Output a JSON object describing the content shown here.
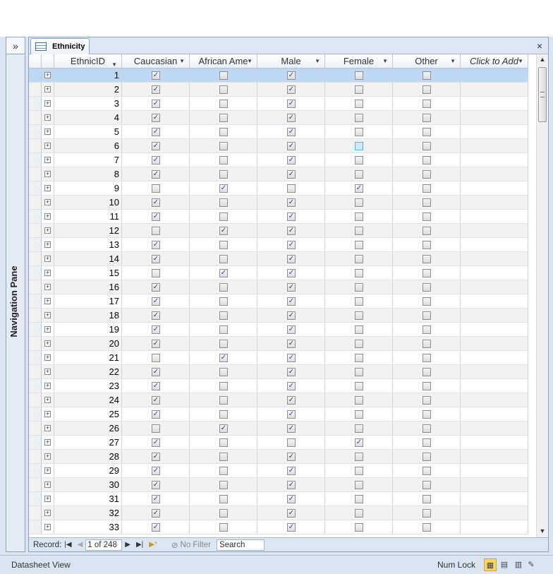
{
  "nav_pane": {
    "toggle": "»",
    "label": "Navigation Pane"
  },
  "tab": {
    "label": "Ethnicity",
    "close": "×"
  },
  "columns": [
    "EthnicID",
    "Caucasian",
    "African Ame",
    "Male",
    "Female",
    "Other",
    "Click to Add"
  ],
  "rows": [
    {
      "id": "1",
      "cau": 1,
      "afr": 0,
      "male": 1,
      "fem": 0,
      "oth": 0
    },
    {
      "id": "2",
      "cau": 1,
      "afr": 0,
      "male": 1,
      "fem": 0,
      "oth": 0
    },
    {
      "id": "3",
      "cau": 1,
      "afr": 0,
      "male": 1,
      "fem": 0,
      "oth": 0
    },
    {
      "id": "4",
      "cau": 1,
      "afr": 0,
      "male": 1,
      "fem": 0,
      "oth": 0
    },
    {
      "id": "5",
      "cau": 1,
      "afr": 0,
      "male": 1,
      "fem": 0,
      "oth": 0
    },
    {
      "id": "6",
      "cau": 1,
      "afr": 0,
      "male": 1,
      "fem": 0,
      "oth": 0
    },
    {
      "id": "7",
      "cau": 1,
      "afr": 0,
      "male": 1,
      "fem": 0,
      "oth": 0
    },
    {
      "id": "8",
      "cau": 1,
      "afr": 0,
      "male": 1,
      "fem": 0,
      "oth": 0
    },
    {
      "id": "9",
      "cau": 0,
      "afr": 1,
      "male": 0,
      "fem": 1,
      "oth": 0
    },
    {
      "id": "10",
      "cau": 1,
      "afr": 0,
      "male": 1,
      "fem": 0,
      "oth": 0
    },
    {
      "id": "11",
      "cau": 1,
      "afr": 0,
      "male": 1,
      "fem": 0,
      "oth": 0
    },
    {
      "id": "12",
      "cau": 0,
      "afr": 1,
      "male": 1,
      "fem": 0,
      "oth": 0
    },
    {
      "id": "13",
      "cau": 1,
      "afr": 0,
      "male": 1,
      "fem": 0,
      "oth": 0
    },
    {
      "id": "14",
      "cau": 1,
      "afr": 0,
      "male": 1,
      "fem": 0,
      "oth": 0
    },
    {
      "id": "15",
      "cau": 0,
      "afr": 1,
      "male": 1,
      "fem": 0,
      "oth": 0
    },
    {
      "id": "16",
      "cau": 1,
      "afr": 0,
      "male": 1,
      "fem": 0,
      "oth": 0
    },
    {
      "id": "17",
      "cau": 1,
      "afr": 0,
      "male": 1,
      "fem": 0,
      "oth": 0
    },
    {
      "id": "18",
      "cau": 1,
      "afr": 0,
      "male": 1,
      "fem": 0,
      "oth": 0
    },
    {
      "id": "19",
      "cau": 1,
      "afr": 0,
      "male": 1,
      "fem": 0,
      "oth": 0
    },
    {
      "id": "20",
      "cau": 1,
      "afr": 0,
      "male": 1,
      "fem": 0,
      "oth": 0
    },
    {
      "id": "21",
      "cau": 0,
      "afr": 1,
      "male": 1,
      "fem": 0,
      "oth": 0
    },
    {
      "id": "22",
      "cau": 1,
      "afr": 0,
      "male": 1,
      "fem": 0,
      "oth": 0
    },
    {
      "id": "23",
      "cau": 1,
      "afr": 0,
      "male": 1,
      "fem": 0,
      "oth": 0
    },
    {
      "id": "24",
      "cau": 1,
      "afr": 0,
      "male": 1,
      "fem": 0,
      "oth": 0
    },
    {
      "id": "25",
      "cau": 1,
      "afr": 0,
      "male": 1,
      "fem": 0,
      "oth": 0
    },
    {
      "id": "26",
      "cau": 0,
      "afr": 1,
      "male": 1,
      "fem": 0,
      "oth": 0
    },
    {
      "id": "27",
      "cau": 1,
      "afr": 0,
      "male": 0,
      "fem": 1,
      "oth": 0
    },
    {
      "id": "28",
      "cau": 1,
      "afr": 0,
      "male": 1,
      "fem": 0,
      "oth": 0
    },
    {
      "id": "29",
      "cau": 1,
      "afr": 0,
      "male": 1,
      "fem": 0,
      "oth": 0
    },
    {
      "id": "30",
      "cau": 1,
      "afr": 0,
      "male": 1,
      "fem": 0,
      "oth": 0
    },
    {
      "id": "31",
      "cau": 1,
      "afr": 0,
      "male": 1,
      "fem": 0,
      "oth": 0
    },
    {
      "id": "32",
      "cau": 1,
      "afr": 0,
      "male": 1,
      "fem": 0,
      "oth": 0
    },
    {
      "id": "33",
      "cau": 1,
      "afr": 0,
      "male": 1,
      "fem": 0,
      "oth": 0
    }
  ],
  "selected_row": "1",
  "focused_checkbox": {
    "row": "6",
    "field": "fem"
  },
  "record_nav": {
    "label": "Record:",
    "current": "1 of 248",
    "filter": "No Filter",
    "search": "Search"
  },
  "status": {
    "view": "Datasheet View",
    "numlock": "Num Lock"
  },
  "icons": [
    "datasheet-view-icon",
    "pivot-table-icon",
    "pivot-chart-icon",
    "design-view-icon"
  ],
  "colors": {
    "selected_row": "#bcd8f5",
    "frame": "#dbe5f1"
  }
}
